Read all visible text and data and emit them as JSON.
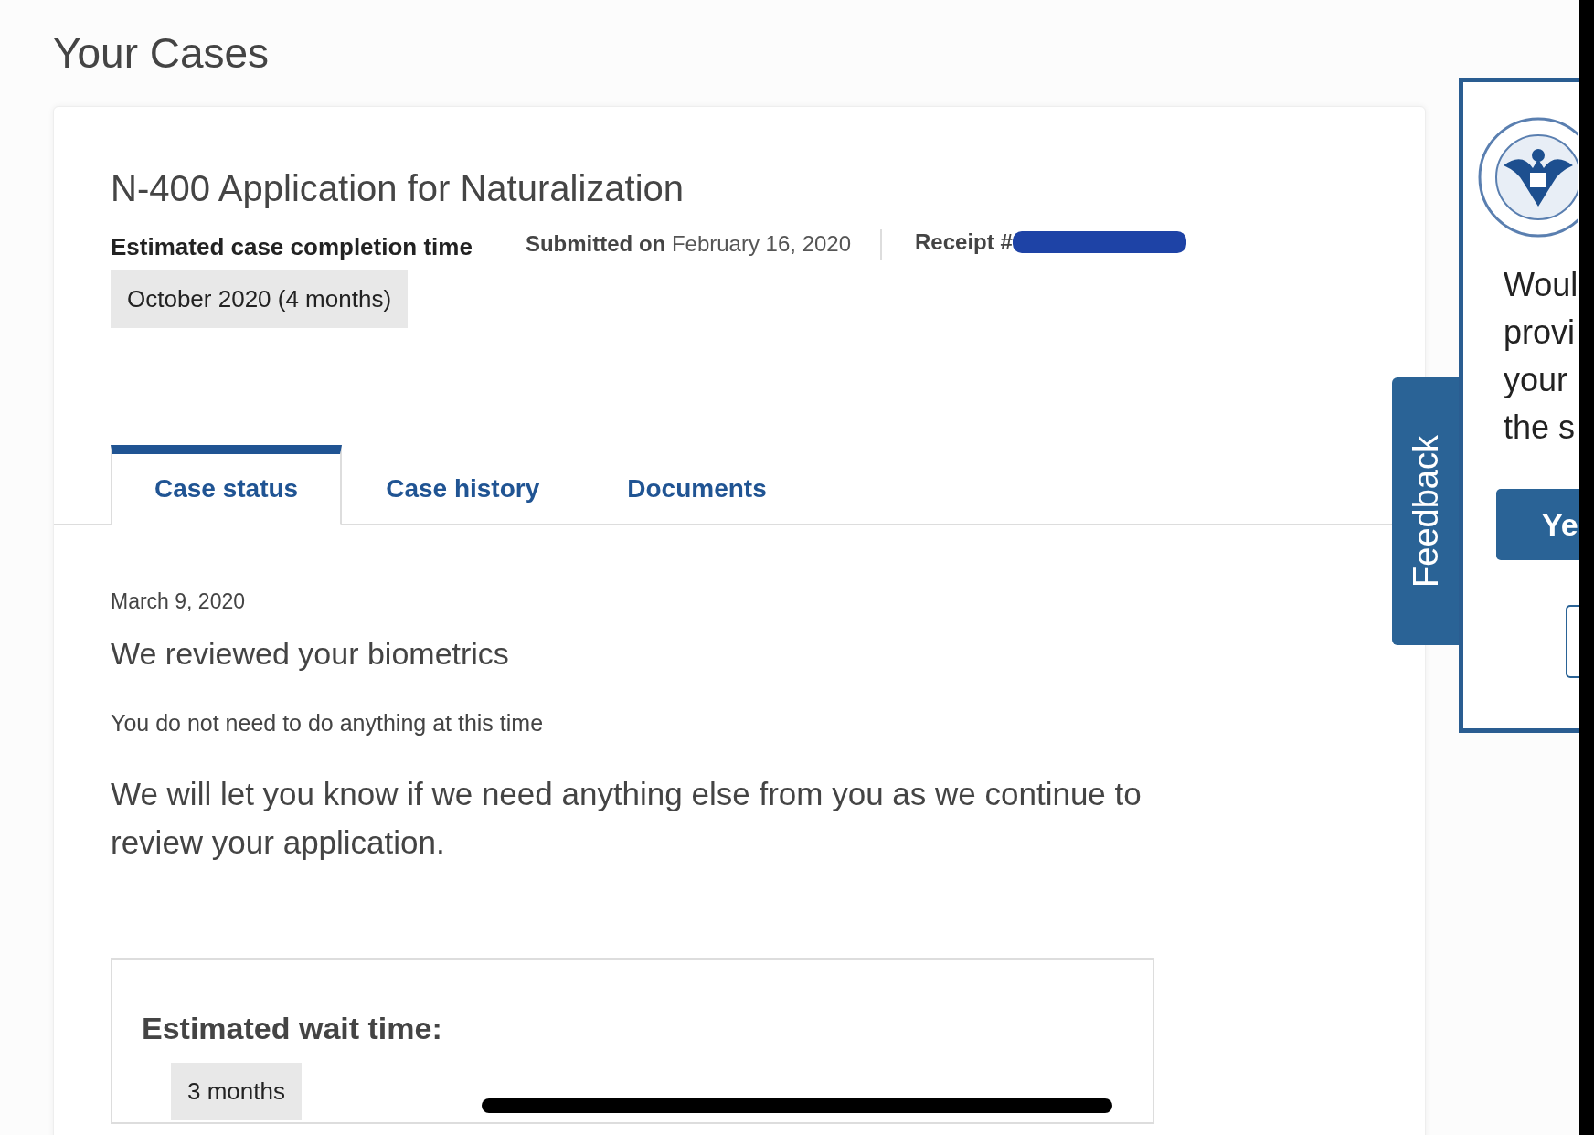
{
  "page_title": "Your Cases",
  "case": {
    "title": "N-400 Application for Naturalization",
    "completion_label": "Estimated case completion time",
    "completion_value": "October 2020 (4 months)",
    "submitted_label": "Submitted on",
    "submitted_date": "February 16, 2020",
    "receipt_label": "Receipt #",
    "receipt_redacted": true
  },
  "tabs": [
    {
      "label": "Case status",
      "selected": true
    },
    {
      "label": "Case history",
      "selected": false
    },
    {
      "label": "Documents",
      "selected": false
    }
  ],
  "status": {
    "date": "March 9, 2020",
    "heading": "We reviewed your biometrics",
    "note": "You do not need to do anything at this time",
    "message": "We will let you know if we need anything else from you as we continue to review your application."
  },
  "wait": {
    "label": "Estimated wait time:",
    "value": "3 months"
  },
  "feedback_tab": "Feedback",
  "survey_popup": {
    "lines": [
      "Woul",
      "provi",
      "your",
      "the s"
    ],
    "yes_button": "Ye"
  }
}
